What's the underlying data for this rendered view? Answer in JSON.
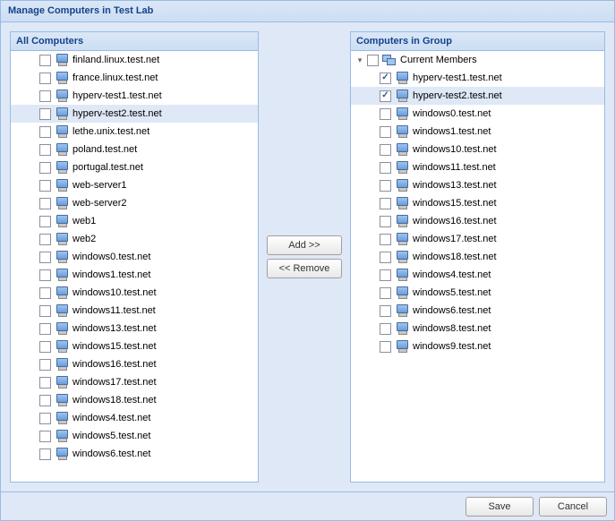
{
  "dialog_title": "Manage Computers in Test Lab",
  "left_panel": {
    "title": "All Computers",
    "items": [
      {
        "label": "finland.linux.test.net",
        "checked": false,
        "selected": false
      },
      {
        "label": "france.linux.test.net",
        "checked": false,
        "selected": false
      },
      {
        "label": "hyperv-test1.test.net",
        "checked": false,
        "selected": false
      },
      {
        "label": "hyperv-test2.test.net",
        "checked": false,
        "selected": true
      },
      {
        "label": "lethe.unix.test.net",
        "checked": false,
        "selected": false
      },
      {
        "label": "poland.test.net",
        "checked": false,
        "selected": false
      },
      {
        "label": "portugal.test.net",
        "checked": false,
        "selected": false
      },
      {
        "label": "web-server1",
        "checked": false,
        "selected": false
      },
      {
        "label": "web-server2",
        "checked": false,
        "selected": false
      },
      {
        "label": "web1",
        "checked": false,
        "selected": false
      },
      {
        "label": "web2",
        "checked": false,
        "selected": false
      },
      {
        "label": "windows0.test.net",
        "checked": false,
        "selected": false
      },
      {
        "label": "windows1.test.net",
        "checked": false,
        "selected": false
      },
      {
        "label": "windows10.test.net",
        "checked": false,
        "selected": false
      },
      {
        "label": "windows11.test.net",
        "checked": false,
        "selected": false
      },
      {
        "label": "windows13.test.net",
        "checked": false,
        "selected": false
      },
      {
        "label": "windows15.test.net",
        "checked": false,
        "selected": false
      },
      {
        "label": "windows16.test.net",
        "checked": false,
        "selected": false
      },
      {
        "label": "windows17.test.net",
        "checked": false,
        "selected": false
      },
      {
        "label": "windows18.test.net",
        "checked": false,
        "selected": false
      },
      {
        "label": "windows4.test.net",
        "checked": false,
        "selected": false
      },
      {
        "label": "windows5.test.net",
        "checked": false,
        "selected": false
      },
      {
        "label": "windows6.test.net",
        "checked": false,
        "selected": false
      }
    ]
  },
  "right_panel": {
    "title": "Computers in Group",
    "root": {
      "label": "Current Members",
      "checked": false,
      "expanded": true
    },
    "items": [
      {
        "label": "hyperv-test1.test.net",
        "checked": true,
        "selected": false
      },
      {
        "label": "hyperv-test2.test.net",
        "checked": true,
        "selected": true
      },
      {
        "label": "windows0.test.net",
        "checked": false,
        "selected": false
      },
      {
        "label": "windows1.test.net",
        "checked": false,
        "selected": false
      },
      {
        "label": "windows10.test.net",
        "checked": false,
        "selected": false
      },
      {
        "label": "windows11.test.net",
        "checked": false,
        "selected": false
      },
      {
        "label": "windows13.test.net",
        "checked": false,
        "selected": false
      },
      {
        "label": "windows15.test.net",
        "checked": false,
        "selected": false
      },
      {
        "label": "windows16.test.net",
        "checked": false,
        "selected": false
      },
      {
        "label": "windows17.test.net",
        "checked": false,
        "selected": false
      },
      {
        "label": "windows18.test.net",
        "checked": false,
        "selected": false
      },
      {
        "label": "windows4.test.net",
        "checked": false,
        "selected": false
      },
      {
        "label": "windows5.test.net",
        "checked": false,
        "selected": false
      },
      {
        "label": "windows6.test.net",
        "checked": false,
        "selected": false
      },
      {
        "label": "windows8.test.net",
        "checked": false,
        "selected": false
      },
      {
        "label": "windows9.test.net",
        "checked": false,
        "selected": false
      }
    ]
  },
  "buttons": {
    "add": "Add >>",
    "remove": "<< Remove",
    "save": "Save",
    "cancel": "Cancel"
  }
}
